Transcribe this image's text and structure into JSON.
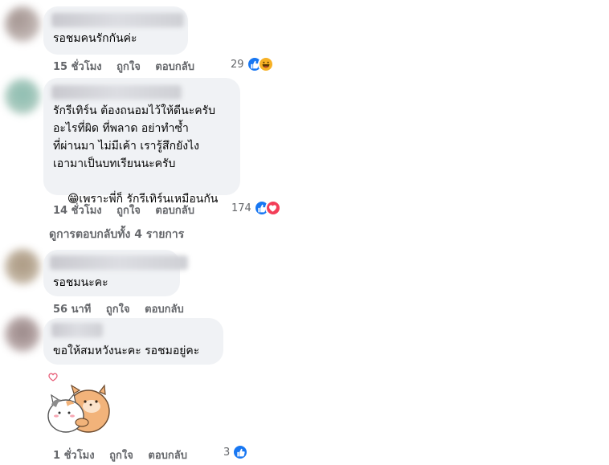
{
  "comments": [
    {
      "text": "รอชมคนรักกันค่ะ",
      "time": "15 ชั่วโมง",
      "like": "ถูกใจ",
      "reply": "ตอบกลับ",
      "reaction_count": "29",
      "reactions": [
        "like-icon",
        "haha-icon"
      ]
    },
    {
      "text_lines": [
        "รักรีเทิร์น ต้องถนอมไว้ให้ดีนะครับ",
        "อะไรที่ผิด ที่พลาด อย่าทำซ้ำ",
        "ที่ผ่านมา ไม่มีเค้า เรารู้สึกยังไง",
        "เอามาเป็นบทเรียนนะครับ",
        "เพราะพี่ก็ รักรีเทิร์นเหมือนกัน"
      ],
      "emoji": "😁",
      "time": "14 ชั่วโมง",
      "like": "ถูกใจ",
      "reply": "ตอบกลับ",
      "reaction_count": "174",
      "reactions": [
        "like-icon",
        "love-icon"
      ]
    }
  ],
  "view_replies": "ดูการตอบกลับทั้ง 4 รายการ",
  "replies": [
    {
      "text": "รอชมนะคะ",
      "time": "56 นาที",
      "like": "ถูกใจ",
      "reply": "ตอบกลับ"
    },
    {
      "text": "ขอให้สมหวังนะคะ รอชมอยู่คะ",
      "sticker": "cat-and-dog-hug-sticker",
      "time": "1 ชั่วโมง",
      "like": "ถูกใจ",
      "reply": "ตอบกลับ",
      "reaction_count": "3",
      "reactions": [
        "like-icon"
      ]
    }
  ],
  "colors": {
    "bubble": "#f0f2f5",
    "meta": "#65676b",
    "like_blue": "#1877f2",
    "love_red": "#f33e58",
    "haha_yellow": "#f7b125"
  }
}
